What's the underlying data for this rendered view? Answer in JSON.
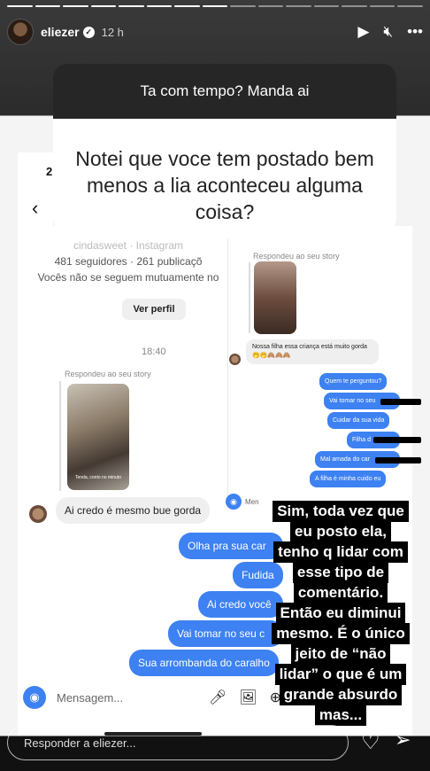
{
  "header": {
    "username": "eliezer",
    "time": "12 h"
  },
  "question": {
    "prompt": "Ta com tempo? Manda ai",
    "text": "Notei que voce tem postado bem menos a lia aconteceu alguma coisa?"
  },
  "side": {
    "number": "2",
    "back_icon": "chevron-left-icon"
  },
  "screenshot": {
    "profile": {
      "name_line": "cindasweet · Instagram",
      "stats": "481 seguidores · 261 publicaçõ",
      "mutual": "Vocês não se seguem mutuamente no",
      "view_profile": "Ver perfil"
    },
    "timestamp": "18:40",
    "replied_label_right": "Respondeu ao seu story",
    "replied_label_left": "Respondeu ao seu story",
    "thumb_caption": "Tenda, conto no minuto",
    "right_column": {
      "received": "Nossa filha essa criança está muito gorda 🤭🤭🙈🙈🙈",
      "sent": [
        "Quem te perguntou?",
        "Vai tomar no seu",
        "Cuidar da sua vida",
        "Filha d",
        "Mal amada do car",
        "A filha é minha cuido eu"
      ],
      "message_placeholder": "Men"
    },
    "left_column": {
      "received": "Ai credo é mesmo bue gorda",
      "sent": [
        "Olha pra sua car",
        "Fudida",
        "Ai credo você",
        "Vai tomar no seu c",
        "Sua arrombanda do caralho"
      ],
      "message_placeholder": "Mensagem..."
    }
  },
  "overlay_text": [
    "Sim, toda vez que",
    "eu posto ela,",
    "tenho q lidar com",
    "esse tipo de",
    "comentário.",
    "Então eu diminui",
    "mesmo. É o único",
    "jeito de “não",
    "lidar” o que é um",
    "grande absurdo",
    "mas..."
  ],
  "reply": {
    "placeholder": "Responder a eliezer..."
  },
  "icons": [
    "play-icon",
    "mute-icon",
    "more-icon",
    "heart-icon",
    "send-icon",
    "camera-icon",
    "mic-icon",
    "gallery-icon",
    "add-icon"
  ]
}
